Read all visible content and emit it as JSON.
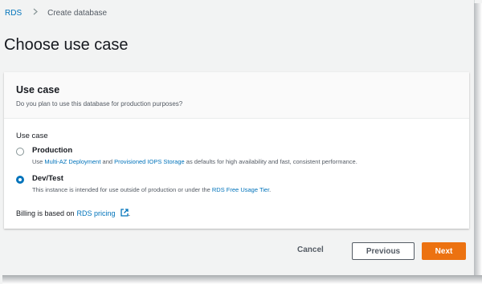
{
  "breadcrumb": {
    "items": [
      "RDS",
      "Create database"
    ]
  },
  "page": {
    "title": "Choose use case"
  },
  "card": {
    "title": "Use case",
    "description": "Do you plan to use this database for production purposes?",
    "field_label": "Use case",
    "options": [
      {
        "title": "Production",
        "checked": false,
        "desc_prefix": "Use ",
        "link1": "Multi-AZ Deployment",
        "desc_mid": " and ",
        "link2": "Provisioned IOPS Storage",
        "desc_suffix": " as defaults for high availability and fast, consistent performance."
      },
      {
        "title": "Dev/Test",
        "checked": true,
        "desc_prefix": "This instance is intended for use outside of production or under the ",
        "link1": "RDS Free Usage Tier",
        "desc_suffix": "."
      }
    ],
    "billing": {
      "prefix": "Billing is based on ",
      "link": "RDS pricing",
      "suffix": "."
    }
  },
  "footer": {
    "cancel_label": "Cancel",
    "previous_label": "Previous",
    "next_label": "Next"
  },
  "colors": {
    "accent": "#0073bb",
    "primary_button": "#ec7211"
  },
  "icons": [
    "chevron-right-icon",
    "external-link-icon"
  ]
}
